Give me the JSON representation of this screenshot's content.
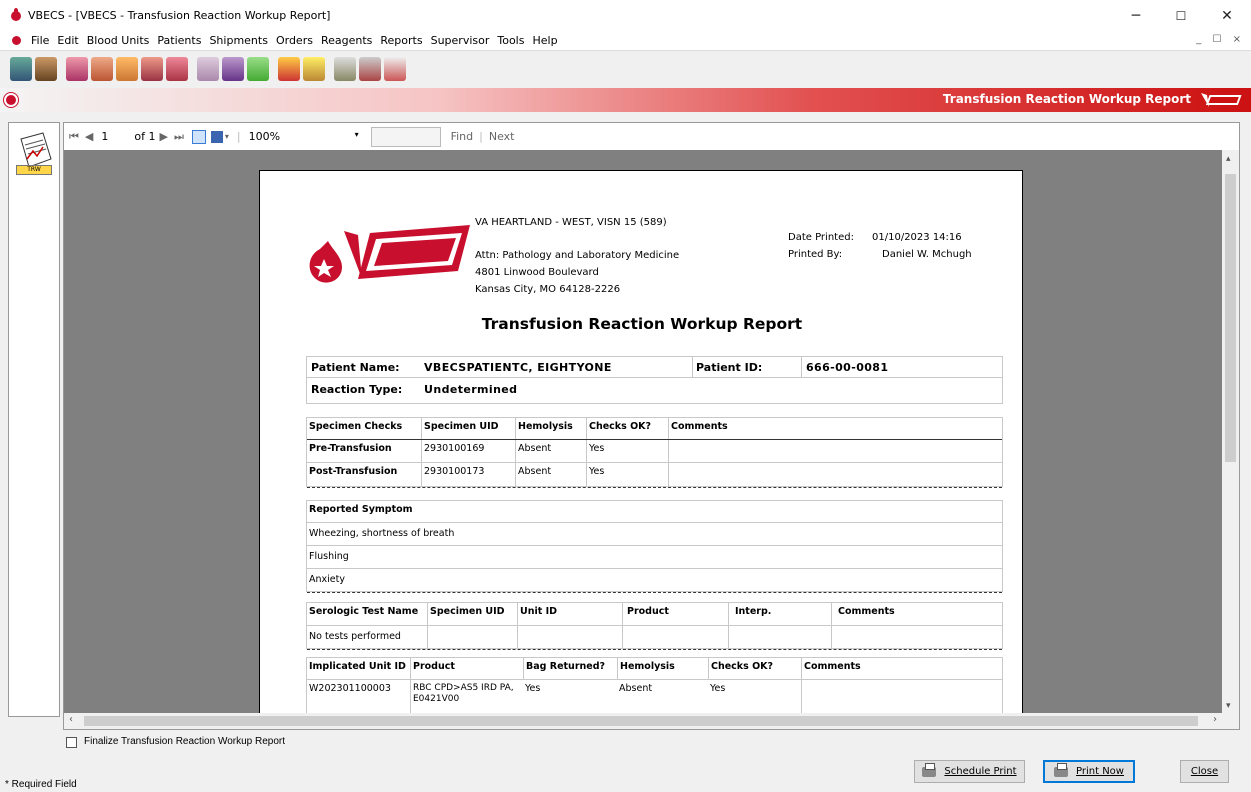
{
  "window": {
    "title": "VBECS - [VBECS - Transfusion Reaction Workup Report]",
    "minimize": "─",
    "maximize": "☐",
    "close": "✕"
  },
  "menu": [
    "File",
    "Edit",
    "Blood Units",
    "Patients",
    "Shipments",
    "Orders",
    "Reagents",
    "Reports",
    "Supervisor",
    "Tools",
    "Help"
  ],
  "mdi_controls": "_ ☐ ×",
  "banner": {
    "title": "Transfusion Reaction Workup Report",
    "accent": "#cc1111"
  },
  "trw_label": "TRW",
  "viewer": {
    "first": "⏮",
    "prev": "◀",
    "page": "1",
    "of": "of 1",
    "next": "▶",
    "last": "⏭",
    "zoom": "100%",
    "find": "Find",
    "sep": "|",
    "next_label": "Next"
  },
  "report": {
    "org": "VA HEARTLAND - WEST, VISN 15 (589)",
    "attn": "Attn: Pathology and Laboratory Medicine",
    "addr1": "4801 Linwood Boulevard",
    "addr2": "Kansas City, MO 64128-2226",
    "date_label": "Date Printed:",
    "date_value": "01/10/2023 14:16",
    "by_label": "Printed By:",
    "by_value": "Daniel W. Mchugh",
    "title": "Transfusion Reaction Workup Report",
    "patient_name_label": "Patient Name:",
    "patient_name": "VBECSPATIENTC, EIGHTYONE",
    "patient_id_label": "Patient ID:",
    "patient_id": "666-00-0081",
    "reaction_label": "Reaction Type:",
    "reaction": "Undetermined",
    "specimen_headers": [
      "Specimen Checks",
      "Specimen UID",
      "Hemolysis",
      "Checks OK?",
      "Comments"
    ],
    "specimen_rows": [
      [
        "Pre-Transfusion",
        "2930100169",
        "Absent",
        "Yes",
        ""
      ],
      [
        "Post-Transfusion",
        "2930100173",
        "Absent",
        "Yes",
        ""
      ]
    ],
    "symptom_header": "Reported Symptom",
    "symptoms": [
      "Wheezing, shortness of breath",
      "Flushing",
      "Anxiety"
    ],
    "serology_headers": [
      "Serologic Test Name",
      "Specimen UID",
      "Unit ID",
      "Product",
      "Interp.",
      "Comments"
    ],
    "serology_rows": [
      [
        "No tests performed",
        "",
        "",
        "",
        "",
        ""
      ]
    ],
    "unit_headers": [
      "Implicated Unit ID",
      "Product",
      "Bag Returned?",
      "Hemolysis",
      "Checks OK?",
      "Comments"
    ],
    "unit_rows": [
      [
        "W202301100003",
        "RBC CPD>AS5 IRD PA, E0421V00",
        "Yes",
        "Absent",
        "Yes",
        ""
      ]
    ]
  },
  "finalize_label": "Finalize Transfusion Reaction Workup Report",
  "required_label": "* Required Field",
  "buttons": {
    "schedule": "Schedule Print",
    "print_now": "Print Now",
    "close": "Close"
  }
}
